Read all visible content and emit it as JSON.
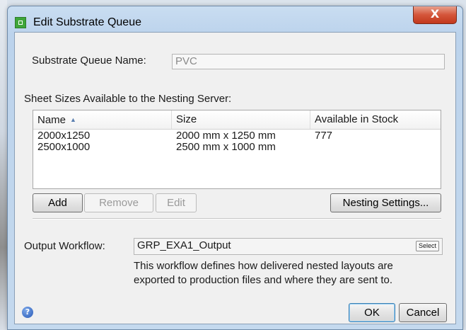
{
  "window": {
    "title": "Edit Substrate Queue",
    "close_glyph": "X"
  },
  "form": {
    "queue_name_label": "Substrate Queue Name:",
    "queue_name_value": "PVC",
    "sheet_sizes_label": "Sheet Sizes Available to the Nesting Server:"
  },
  "table": {
    "columns": [
      "Name",
      "Size",
      "Available in Stock"
    ],
    "sort_column": "Name",
    "rows": [
      {
        "name": "2000x1250",
        "size": "2000 mm x 1250 mm",
        "stock": "777"
      },
      {
        "name": "2500x1000",
        "size": "2500 mm x 1000 mm",
        "stock": ""
      }
    ]
  },
  "buttons": {
    "add": "Add",
    "remove": "Remove",
    "edit": "Edit",
    "nesting_settings": "Nesting Settings...",
    "select": "Select",
    "ok": "OK",
    "cancel": "Cancel"
  },
  "workflow": {
    "label": "Output Workflow:",
    "value": "GRP_EXA1_Output",
    "description_line1": "This workflow defines how delivered nested layouts are",
    "description_line2": "exported to production files and where they are sent to."
  },
  "icons": {
    "app": "app-icon",
    "help": "help-icon",
    "sort": "sort-ascending-icon"
  },
  "colors": {
    "title_gradient": "#bcd3ec",
    "close_button": "#c2381c",
    "default_button_border": "#3c7fb1"
  }
}
